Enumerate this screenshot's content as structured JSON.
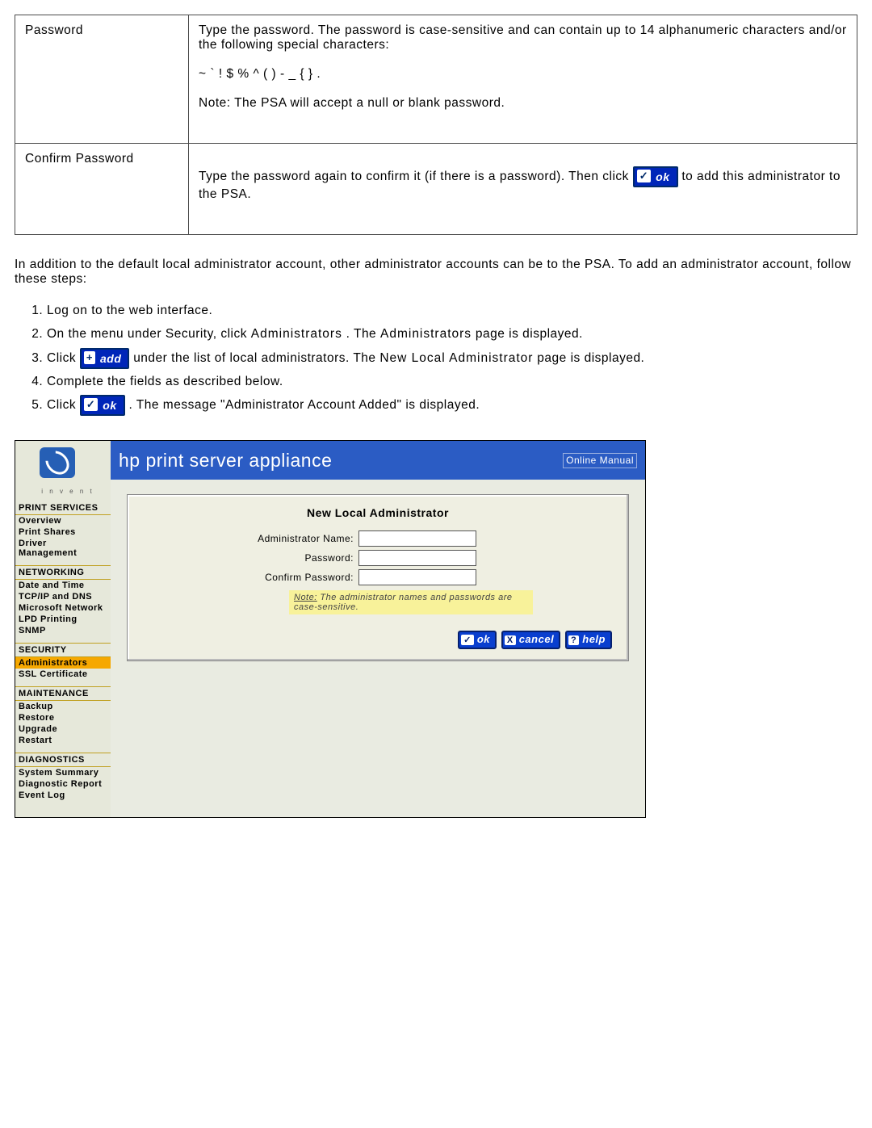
{
  "defs": {
    "row1": {
      "label": "Password",
      "p1": "Type the password. The password is case-sensitive and can contain up to 14 alphanumeric characters and/or the following special characters:",
      "p2": "~ ` ! $ % ^ ( ) - _ { } .",
      "p3": "Note: The PSA will accept a null or blank password."
    },
    "row2": {
      "label": "Confirm Password",
      "pA": "Type the password again to confirm it (if there is a password). Then click ",
      "pB": " to add this administrator to the PSA."
    }
  },
  "okbtn": {
    "icon": "✓",
    "label": "ok"
  },
  "addbtn": {
    "icon": "+",
    "label": "add"
  },
  "para": "In addition to the default local administrator account, other administrator accounts can be to the PSA. To add an administrator account, follow these steps:",
  "steps": {
    "s1": "Log on to the web interface.",
    "s2a": "On the menu under Security, click ",
    "s2b": "Administrators",
    "s2c": ". The ",
    "s2d": "Administrators",
    "s2e": " page is displayed.",
    "s3a": "Click ",
    "s3b": " under the list of local administrators. The ",
    "s3c": "New Local Administrator",
    "s3d": " page is displayed.",
    "s4": "Complete the fields as described below.",
    "s5a": "Click ",
    "s5b": ". The message \"Administrator Account Added\" is displayed."
  },
  "shot": {
    "bar_title": "hp print server appliance",
    "manual": "Online Manual",
    "nav": {
      "h1": "PRINT SERVICES",
      "i1": "Overview",
      "i2": "Print Shares",
      "i3": "Driver Management",
      "h2": "NETWORKING",
      "i4": "Date and Time",
      "i5": "TCP/IP and DNS",
      "i6": "Microsoft Network",
      "i7": "LPD Printing",
      "i8": "SNMP",
      "h3": "SECURITY",
      "i9": "Administrators",
      "i10": "SSL Certificate",
      "h4": "MAINTENANCE",
      "i11": "Backup",
      "i12": "Restore",
      "i13": "Upgrade",
      "i14": "Restart",
      "h5": "DIAGNOSTICS",
      "i15": "System Summary",
      "i16": "Diagnostic Report",
      "i17": "Event Log"
    },
    "panel": {
      "title": "New Local Administrator",
      "f1": "Administrator Name:",
      "f2": "Password:",
      "f3": "Confirm Password:",
      "note_label": "Note:",
      "note": " The administrator names and passwords are case-sensitive.",
      "ok": "ok",
      "cancel": "cancel",
      "help": "help",
      "ok_i": "✓",
      "cancel_i": "X",
      "help_i": "?"
    }
  }
}
